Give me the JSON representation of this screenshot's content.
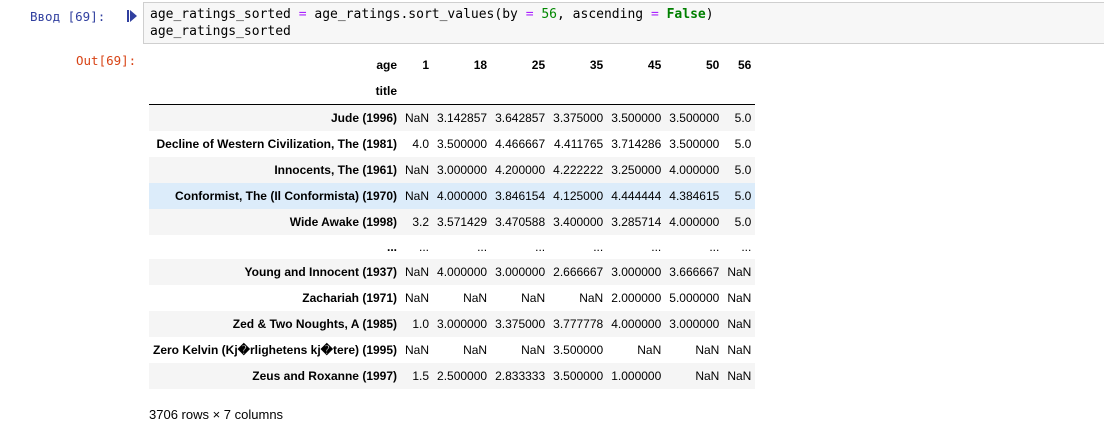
{
  "input_cell": {
    "prompt": "Ввод [69]:",
    "code_lines": [
      [
        {
          "t": "age_ratings_sorted ",
          "c": ""
        },
        {
          "t": "=",
          "c": "op"
        },
        {
          "t": " age_ratings.sort_values(by ",
          "c": ""
        },
        {
          "t": "=",
          "c": "op"
        },
        {
          "t": " ",
          "c": ""
        },
        {
          "t": "56",
          "c": "num"
        },
        {
          "t": ", ascending ",
          "c": ""
        },
        {
          "t": "=",
          "c": "op"
        },
        {
          "t": " ",
          "c": ""
        },
        {
          "t": "False",
          "c": "kw"
        },
        {
          "t": ")",
          "c": ""
        }
      ],
      [
        {
          "t": "age_ratings_sorted",
          "c": ""
        }
      ]
    ]
  },
  "output_cell": {
    "prompt": "Out[69]:",
    "table": {
      "column_index_name": "age",
      "row_index_name": "title",
      "columns": [
        "1",
        "18",
        "25",
        "35",
        "45",
        "50",
        "56"
      ],
      "rows": [
        {
          "title": "Jude (1996)",
          "values": [
            "NaN",
            "3.142857",
            "3.642857",
            "3.375000",
            "3.500000",
            "3.500000",
            "5.0"
          ]
        },
        {
          "title": "Decline of Western Civilization, The (1981)",
          "values": [
            "4.0",
            "3.500000",
            "4.466667",
            "4.411765",
            "3.714286",
            "3.500000",
            "5.0"
          ]
        },
        {
          "title": "Innocents, The (1961)",
          "values": [
            "NaN",
            "3.000000",
            "4.200000",
            "4.222222",
            "3.250000",
            "4.000000",
            "5.0"
          ]
        },
        {
          "title": "Conformist, The (Il Conformista) (1970)",
          "values": [
            "NaN",
            "4.000000",
            "3.846154",
            "4.125000",
            "4.444444",
            "4.384615",
            "5.0"
          ],
          "selected": true
        },
        {
          "title": "Wide Awake (1998)",
          "values": [
            "3.2",
            "3.571429",
            "3.470588",
            "3.400000",
            "3.285714",
            "4.000000",
            "5.0"
          ]
        },
        {
          "title": "...",
          "values": [
            "...",
            "...",
            "...",
            "...",
            "...",
            "...",
            "..."
          ]
        },
        {
          "title": "Young and Innocent (1937)",
          "values": [
            "NaN",
            "4.000000",
            "3.000000",
            "2.666667",
            "3.000000",
            "3.666667",
            "NaN"
          ]
        },
        {
          "title": "Zachariah (1971)",
          "values": [
            "NaN",
            "NaN",
            "NaN",
            "NaN",
            "2.000000",
            "5.000000",
            "NaN"
          ]
        },
        {
          "title": "Zed & Two Noughts, A (1985)",
          "values": [
            "1.0",
            "3.000000",
            "3.375000",
            "3.777778",
            "4.000000",
            "3.000000",
            "NaN"
          ]
        },
        {
          "title": "Zero Kelvin (Kj�rlighetens kj�tere) (1995)",
          "values": [
            "NaN",
            "NaN",
            "NaN",
            "3.500000",
            "NaN",
            "NaN",
            "NaN"
          ]
        },
        {
          "title": "Zeus and Roxanne (1997)",
          "values": [
            "1.5",
            "2.500000",
            "2.833333",
            "3.500000",
            "1.000000",
            "NaN",
            "NaN"
          ]
        }
      ]
    },
    "shape_text": "3706 rows × 7 columns"
  }
}
